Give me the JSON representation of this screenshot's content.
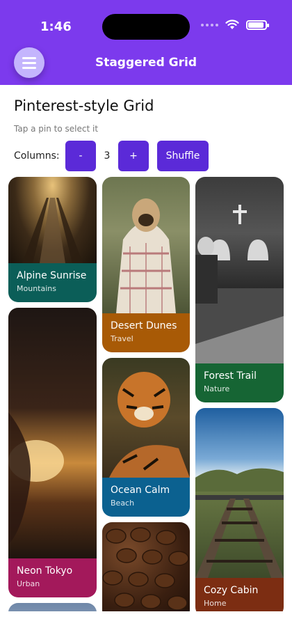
{
  "status_bar": {
    "time": "1:46"
  },
  "header": {
    "title": "Staggered Grid",
    "menu_icon": "hamburger-menu-icon"
  },
  "page": {
    "title": "Pinterest-style Grid",
    "subtitle": "Tap a pin to select it"
  },
  "controls": {
    "label": "Columns:",
    "minus_label": "-",
    "count": "3",
    "plus_label": "+",
    "shuffle_label": "Shuffle"
  },
  "cards": [
    {
      "title": "Alpine Sunrise",
      "category": "Mountains",
      "color": "#0b5e58"
    },
    {
      "title": "Desert Dunes",
      "category": "Travel",
      "color": "#a85a06"
    },
    {
      "title": "Forest Trail",
      "category": "Nature",
      "color": "#166534"
    },
    {
      "title": "Neon Tokyo",
      "category": "Urban",
      "color": "#a3195b"
    },
    {
      "title": "Ocean Calm",
      "category": "Beach",
      "color": "#0b6190"
    },
    {
      "title": "Cozy Cabin",
      "category": "Home",
      "color": "#7c2d12"
    }
  ],
  "colors": {
    "accent": "#7c3aed",
    "button": "#5b2ad8"
  }
}
